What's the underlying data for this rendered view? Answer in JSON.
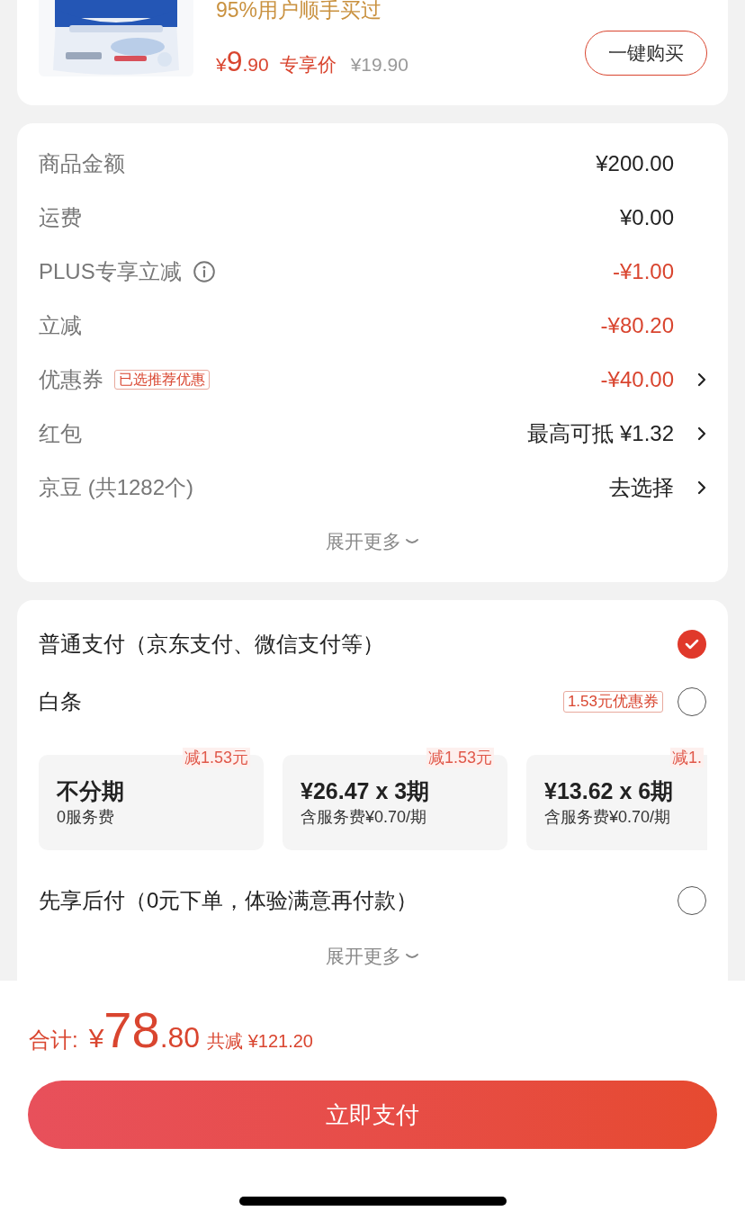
{
  "product": {
    "kind": "picture",
    "tagline": "95%用户顺手买过",
    "price_symbol": "¥",
    "price_int": "9",
    "price_dec": ".90",
    "price_label": "专享价",
    "original_price": "¥19.90",
    "buy_button": "一键购买"
  },
  "summary": {
    "rows": [
      {
        "label": "商品金额",
        "value": "¥200.00",
        "discount": false,
        "chevron": false
      },
      {
        "label": "运费",
        "value": "¥0.00",
        "discount": false,
        "chevron": false
      },
      {
        "label": "PLUS专享立减",
        "info": true,
        "value": "-¥1.00",
        "discount": true,
        "chevron": false
      },
      {
        "label": "立减",
        "value": "-¥80.20",
        "discount": true,
        "chevron": false
      },
      {
        "label": "优惠券",
        "tag": "已选推荐优惠",
        "value": "-¥40.00",
        "discount": true,
        "chevron": true
      },
      {
        "label": "红包",
        "value": "最高可抵 ¥1.32",
        "discount": false,
        "chevron": true
      },
      {
        "label": "京豆 (共1282个)",
        "value": "去选择",
        "discount": false,
        "chevron": true
      }
    ],
    "expand": "展开更多"
  },
  "payment": {
    "methods": [
      {
        "label": "普通支付（京东支付、微信支付等）",
        "selected": true
      },
      {
        "label": "白条",
        "badge": "1.53元优惠券",
        "selected": false,
        "plans": [
          {
            "discount": "减1.53元",
            "title": "不分期",
            "subtitle": "0服务费"
          },
          {
            "discount": "减1.53元",
            "title": "¥26.47 x 3期",
            "subtitle": "含服务费¥0.70/期"
          },
          {
            "discount": "减1.",
            "title": "¥13.62 x 6期",
            "subtitle": "含服务费¥0.70/期"
          }
        ]
      },
      {
        "label": "先享后付（0元下单，体验满意再付款）",
        "selected": false
      }
    ],
    "expand": "展开更多"
  },
  "total": {
    "label": "合计:",
    "symbol": "¥",
    "int": "78",
    "dec": ".80",
    "saved": "共减 ¥121.20"
  },
  "pay_button": "立即支付"
}
